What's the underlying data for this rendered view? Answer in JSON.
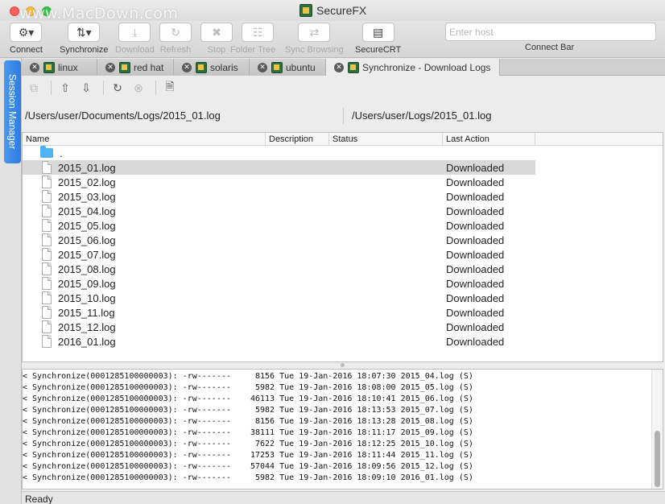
{
  "window": {
    "title": "SecureFX",
    "watermark": "www.MacDown.com"
  },
  "toolbar": {
    "connect": "Connect",
    "synchronize": "Synchronize",
    "download": "Download",
    "refresh": "Refresh",
    "stop": "Stop",
    "folder_tree": "Folder Tree",
    "sync_browsing": "Sync Browsing",
    "securecrt": "SecureCRT",
    "host_placeholder": "Enter host",
    "connect_bar": "Connect Bar"
  },
  "session_manager": "Session Manager",
  "tabs": [
    {
      "label": "linux"
    },
    {
      "label": "red hat"
    },
    {
      "label": "solaris"
    },
    {
      "label": "ubuntu"
    },
    {
      "label": "Synchronize - Download Logs"
    }
  ],
  "paths": {
    "local": "/Users/user/Documents/Logs/2015_01.log",
    "remote": "/Users/user/Logs/2015_01.log"
  },
  "file_list": {
    "columns": [
      "Name",
      "Description",
      "Status",
      "Last Action"
    ],
    "parent": ".",
    "rows": [
      {
        "name": "2015_01.log",
        "action": "Downloaded"
      },
      {
        "name": "2015_02.log",
        "action": "Downloaded"
      },
      {
        "name": "2015_03.log",
        "action": "Downloaded"
      },
      {
        "name": "2015_04.log",
        "action": "Downloaded"
      },
      {
        "name": "2015_05.log",
        "action": "Downloaded"
      },
      {
        "name": "2015_06.log",
        "action": "Downloaded"
      },
      {
        "name": "2015_07.log",
        "action": "Downloaded"
      },
      {
        "name": "2015_08.log",
        "action": "Downloaded"
      },
      {
        "name": "2015_09.log",
        "action": "Downloaded"
      },
      {
        "name": "2015_10.log",
        "action": "Downloaded"
      },
      {
        "name": "2015_11.log",
        "action": "Downloaded"
      },
      {
        "name": "2015_12.log",
        "action": "Downloaded"
      },
      {
        "name": "2016_01.log",
        "action": "Downloaded"
      }
    ]
  },
  "log": [
    "< Synchronize(0001285100000003): -rw-------     8156 Tue 19-Jan-2016 18:07:30 2015_04.log (S)",
    "< Synchronize(0001285100000003): -rw-------     5982 Tue 19-Jan-2016 18:08:00 2015_05.log (S)",
    "< Synchronize(0001285100000003): -rw-------    46113 Tue 19-Jan-2016 18:10:41 2015_06.log (S)",
    "< Synchronize(0001285100000003): -rw-------     5982 Tue 19-Jan-2016 18:13:53 2015_07.log (S)",
    "< Synchronize(0001285100000003): -rw-------     8156 Tue 19-Jan-2016 18:13:28 2015_08.log (S)",
    "< Synchronize(0001285100000003): -rw-------    38111 Tue 19-Jan-2016 18:11:17 2015_09.log (S)",
    "< Synchronize(0001285100000003): -rw-------     7622 Tue 19-Jan-2016 18:12:25 2015_10.log (S)",
    "< Synchronize(0001285100000003): -rw-------    17253 Tue 19-Jan-2016 18:11:44 2015_11.log (S)",
    "< Synchronize(0001285100000003): -rw-------    57044 Tue 19-Jan-2016 18:09:56 2015_12.log (S)",
    "< Synchronize(0001285100000003): -rw-------     5982 Tue 19-Jan-2016 18:09:10 2016_01.log (S)"
  ],
  "status": "Ready"
}
